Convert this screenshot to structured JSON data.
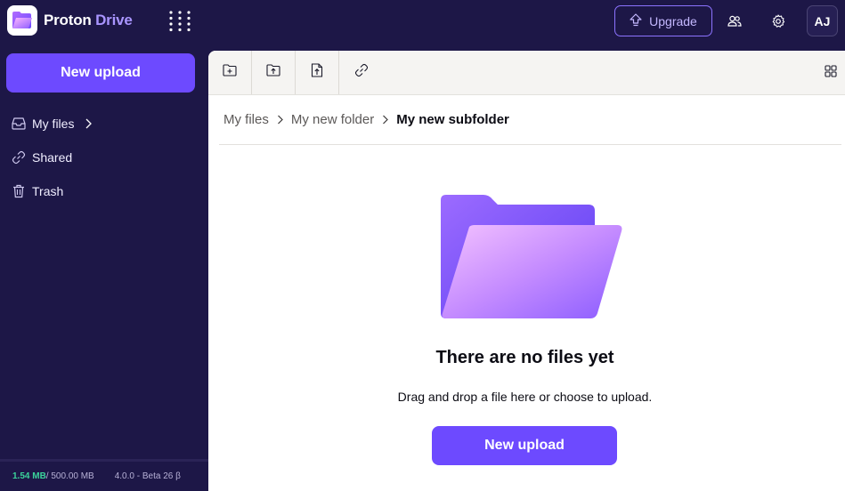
{
  "header": {
    "brand": "Proton",
    "product": "Drive",
    "upgrade_label": "Upgrade",
    "avatar_initials": "AJ"
  },
  "sidebar": {
    "new_upload_label": "New upload",
    "items": [
      {
        "label": "My files",
        "icon": "drive-icon"
      },
      {
        "label": "Shared",
        "icon": "link-icon"
      },
      {
        "label": "Trash",
        "icon": "trash-icon"
      }
    ],
    "storage_used": "1.54 MB",
    "storage_total": " / 500.00 MB",
    "version": "4.0.0 - Beta 26 β"
  },
  "toolbar": {
    "buttons": [
      "new-folder-icon",
      "upload-folder-icon",
      "upload-file-icon",
      "share-link-icon"
    ],
    "view": "grid-view-icon"
  },
  "breadcrumb": [
    "My files",
    "My new folder",
    "My new subfolder"
  ],
  "empty_state": {
    "title": "There are no files yet",
    "subtitle": "Drag and drop a file here or choose to upload.",
    "button_label": "New upload"
  },
  "colors": {
    "brand_purple": "#6d4aff",
    "sidebar_bg": "#1d1747",
    "storage_green": "#3bd39b"
  }
}
